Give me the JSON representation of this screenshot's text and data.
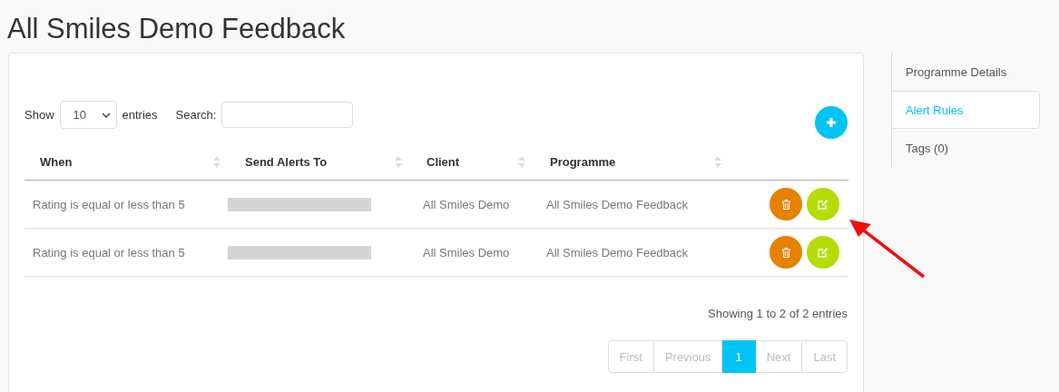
{
  "page": {
    "title": "All Smiles Demo Feedback"
  },
  "length_control": {
    "label_before": "Show",
    "value": "10",
    "label_after": "entries"
  },
  "search": {
    "label": "Search:"
  },
  "table": {
    "columns": [
      "When",
      "Send Alerts To",
      "Client",
      "Programme"
    ],
    "rows": [
      {
        "when": "Rating is equal or less than 5",
        "send_alerts_to_redacted": true,
        "client": "All Smiles Demo",
        "programme": "All Smiles Demo Feedback"
      },
      {
        "when": "Rating is equal or less than 5",
        "send_alerts_to_redacted": true,
        "client": "All Smiles Demo",
        "programme": "All Smiles Demo Feedback"
      }
    ]
  },
  "info": "Showing 1 to 2 of 2 entries",
  "pagination": [
    {
      "label": "First",
      "selected": false
    },
    {
      "label": "Previous",
      "selected": false
    },
    {
      "label": "1",
      "selected": true
    },
    {
      "label": "Next",
      "selected": false
    },
    {
      "label": "Last",
      "selected": false
    }
  ],
  "sidebar": {
    "items": [
      {
        "label": "Programme Details",
        "selected": false
      },
      {
        "label": "Alert Rules",
        "selected": true
      },
      {
        "label": "Tags (0)",
        "selected": false
      }
    ]
  },
  "annotation": {
    "kind": "arrow"
  }
}
